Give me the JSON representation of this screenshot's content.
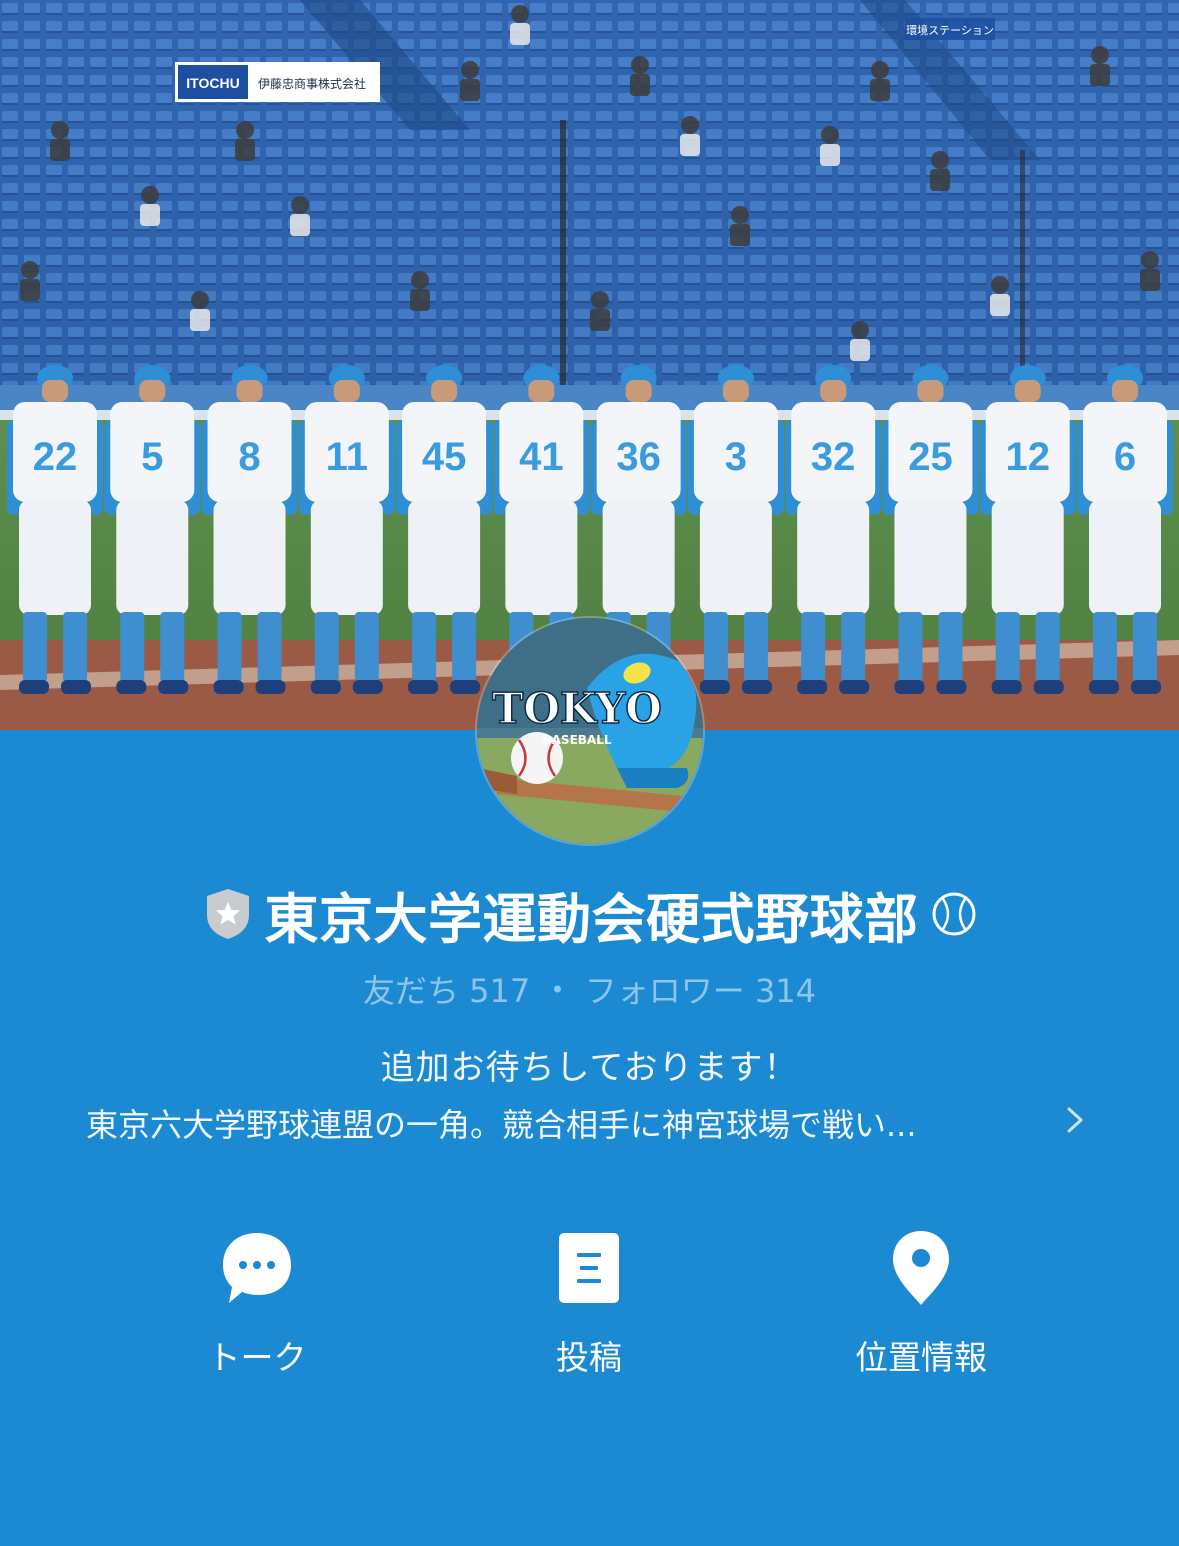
{
  "profile": {
    "name": "東京大学運動会硬式野球部",
    "name_suffix_icon": "baseball-emoji-icon",
    "badge_icon": "official-shield-star-icon",
    "friends_label": "友だち",
    "friends_count": "517",
    "separator": "•",
    "followers_label": "フォロワー",
    "followers_count": "314",
    "status_message": "追加お待ちしております！",
    "description": "東京六大学野球連盟の一角。競合相手に神宮球場で戦い..."
  },
  "cover": {
    "image": "team-lineup-photo",
    "stadium_signs": [
      "ITOCHU",
      "伊藤忠商事株式会社",
      "環境ステーション"
    ],
    "jersey_numbers": [
      "22",
      "5",
      "8",
      "11",
      "45",
      "41",
      "36",
      "3",
      "32",
      "25",
      "12",
      "6"
    ]
  },
  "avatar": {
    "image": "tokyo-baseball-helmet-logo",
    "logo_text": "TOKYO",
    "logo_subtext": "BASEBALL"
  },
  "actions": [
    {
      "label": "トーク",
      "icon": "chat-bubble-icon"
    },
    {
      "label": "投稿",
      "icon": "post-document-icon"
    },
    {
      "label": "位置情報",
      "icon": "location-pin-icon"
    }
  ],
  "colors": {
    "background": "#1b8ad3",
    "stats_text": "#8fc3ea",
    "text": "#ffffff",
    "badge_shield": "#c8ccd1"
  }
}
